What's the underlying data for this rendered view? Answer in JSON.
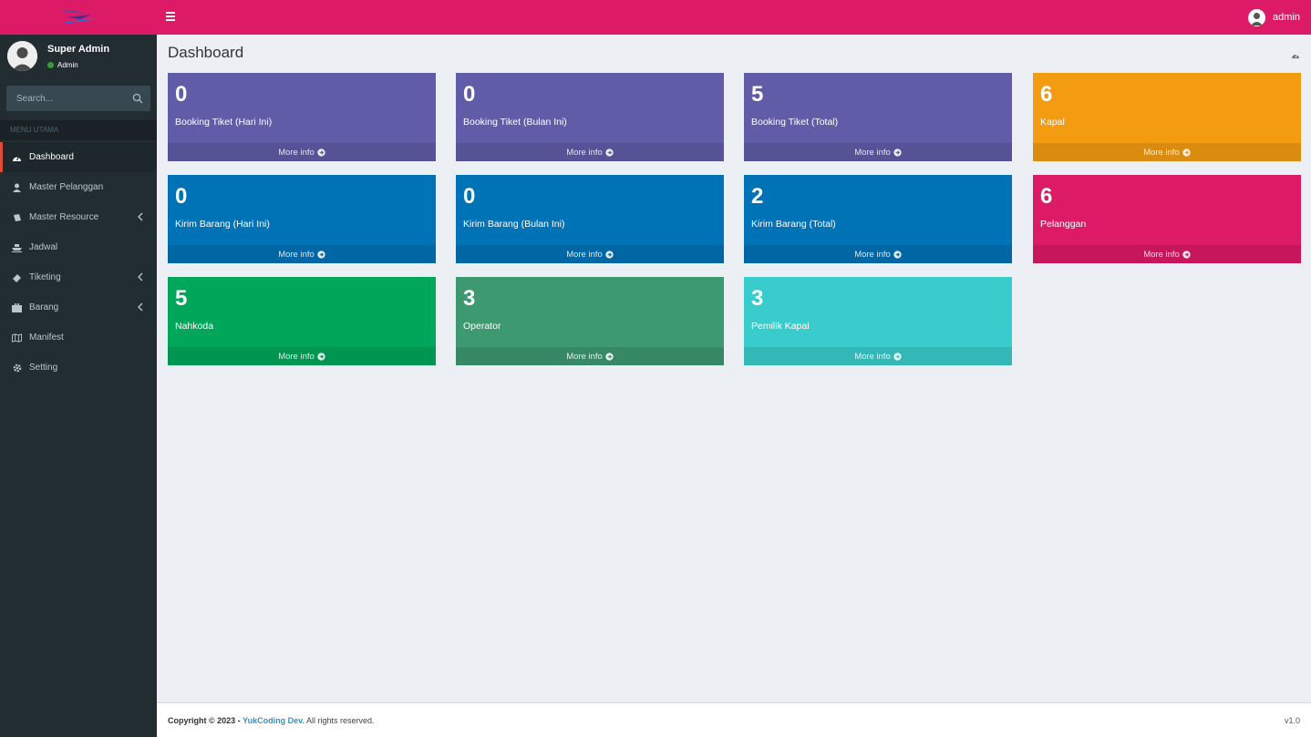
{
  "header": {
    "user_label": "admin",
    "brand_color": "#dd1a65"
  },
  "sidebar": {
    "user_name": "Super Admin",
    "user_role": "Admin",
    "search_placeholder": "Search...",
    "menu_header": "MENU UTAMA",
    "items": [
      {
        "label": "Dashboard",
        "icon": "dashboard-icon",
        "active": true
      },
      {
        "label": "Master Pelanggan",
        "icon": "user-icon"
      },
      {
        "label": "Master Resource",
        "icon": "book-icon",
        "expandable": true
      },
      {
        "label": "Jadwal",
        "icon": "ship-icon"
      },
      {
        "label": "Tiketing",
        "icon": "ticket-icon",
        "expandable": true
      },
      {
        "label": "Barang",
        "icon": "briefcase-icon",
        "expandable": true
      },
      {
        "label": "Manifest",
        "icon": "map-icon"
      },
      {
        "label": "Setting",
        "icon": "gear-icon"
      }
    ]
  },
  "main": {
    "title": "Dashboard",
    "more_info": "More info",
    "boxes": [
      {
        "value": "0",
        "label": "Booking Tiket (Hari Ini)",
        "color": "#605ca8"
      },
      {
        "value": "0",
        "label": "Booking Tiket (Bulan Ini)",
        "color": "#605ca8"
      },
      {
        "value": "5",
        "label": "Booking Tiket (Total)",
        "color": "#605ca8"
      },
      {
        "value": "6",
        "label": "Kapal",
        "color": "#f39c12"
      },
      {
        "value": "0",
        "label": "Kirim Barang (Hari Ini)",
        "color": "#0073b7"
      },
      {
        "value": "0",
        "label": "Kirim Barang (Bulan Ini)",
        "color": "#0073b7"
      },
      {
        "value": "2",
        "label": "Kirim Barang (Total)",
        "color": "#0073b7"
      },
      {
        "value": "6",
        "label": "Pelanggan",
        "color": "#dd1a65"
      },
      {
        "value": "5",
        "label": "Nahkoda",
        "color": "#00a65a"
      },
      {
        "value": "3",
        "label": "Operator",
        "color": "#3d9970"
      },
      {
        "value": "3",
        "label": "Pemilik Kapal",
        "color": "#39cccc"
      }
    ]
  },
  "footer": {
    "copyright": "Copyright © 2023 -",
    "brand": "YukCoding Dev.",
    "rights": "All rights reserved.",
    "version": "v1.0"
  }
}
